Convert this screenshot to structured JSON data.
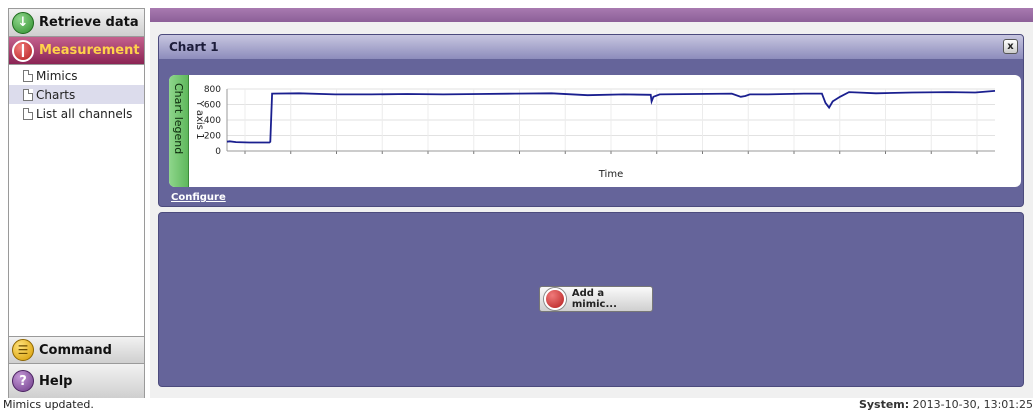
{
  "sidebar": {
    "retrieve_label": "Retrieve data",
    "measurement_label": "Measurement",
    "items": [
      {
        "label": "Mimics"
      },
      {
        "label": "Charts"
      },
      {
        "label": "List all channels"
      }
    ],
    "command_label": "Command",
    "help_label": "Help"
  },
  "chart_panel": {
    "title": "Chart 1",
    "close_label": "x",
    "legend_label": "Chart legend",
    "configure_label": "Configure"
  },
  "mimic_panel": {
    "add_label": "Add a mimic..."
  },
  "status": {
    "message": "Mimics updated.",
    "system_label": "System:",
    "system_time": "2013-10-30, 13:01:25"
  },
  "chart_data": {
    "type": "line",
    "ylabel": "Y axis 1",
    "xlabel": "Time",
    "ylim": [
      0,
      800
    ],
    "yticks": [
      0,
      200,
      400,
      600,
      800
    ],
    "grid": true,
    "x_tick_count": 17,
    "series": [
      {
        "color": "#1a1f8f",
        "x": [
          0,
          3,
          10,
          25,
          47,
          48,
          50,
          80,
          120,
          160,
          200,
          240,
          280,
          320,
          360,
          400,
          440,
          470,
          471,
          473,
          480,
          520,
          560,
          570,
          575,
          580,
          600,
          640,
          660,
          664,
          668,
          672,
          680,
          690,
          700,
          720,
          760,
          800,
          830,
          852
        ],
        "y": [
          120,
          125,
          115,
          110,
          110,
          120,
          740,
          745,
          730,
          730,
          735,
          730,
          735,
          740,
          745,
          720,
          730,
          725,
          640,
          700,
          730,
          735,
          740,
          700,
          710,
          730,
          730,
          740,
          740,
          620,
          560,
          640,
          700,
          760,
          755,
          745,
          755,
          760,
          755,
          775
        ]
      }
    ]
  }
}
